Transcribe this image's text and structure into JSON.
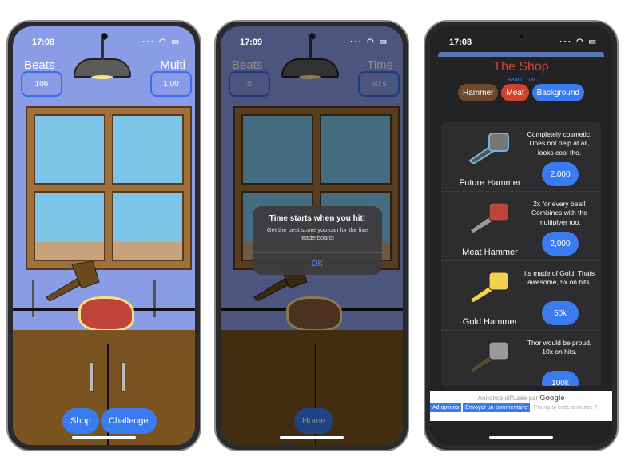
{
  "phones": [
    {
      "time": "17:08",
      "left_label": "Beats",
      "left_value": "106",
      "right_label": "Multi",
      "right_value": "1.00",
      "buttons": [
        "Shop",
        "Challenge"
      ]
    },
    {
      "time": "17:09",
      "left_label": "Beats",
      "left_value": "0",
      "right_label": "Time",
      "right_value": "60 s",
      "buttons": [
        "Home"
      ],
      "alert": {
        "title": "Time starts when you hit!",
        "message": "Get the best score you can for the live leaderboard!",
        "ok": "OK"
      }
    },
    {
      "time": "17:08"
    }
  ],
  "shop": {
    "title": "The Shop",
    "beats": "Beats: 106",
    "tabs": [
      {
        "label": "Hammer",
        "color": "#6b4a2e"
      },
      {
        "label": "Meat",
        "color": "#d1432f"
      },
      {
        "label": "Background",
        "color": "#3b7bf0"
      }
    ],
    "items": [
      {
        "name": "Future Hammer",
        "desc": "Completely cosmetic. Does not help at all, looks cool tho.",
        "price": "2,000",
        "color": "#6fb6e0"
      },
      {
        "name": "Meat Hammer",
        "desc": "2x for every beat! Combines with the multiplyer too.",
        "price": "2,000",
        "color": "#c0443a"
      },
      {
        "name": "Gold Hammer",
        "desc": "Its made of Gold! Thats awesome, 5x on hits.",
        "price": "50k",
        "color": "#f2d24a"
      },
      {
        "name": "",
        "desc": "Thor would be proud, 10x on hits.",
        "price": "100k",
        "color": "#9a9a9a"
      }
    ],
    "ad": {
      "by": "Annonce diffusée par",
      "brand": "Google",
      "options": "Ad options",
      "feedback": "Envoyer un commentaire",
      "why": "Pourquoi cette annonce ?"
    }
  }
}
